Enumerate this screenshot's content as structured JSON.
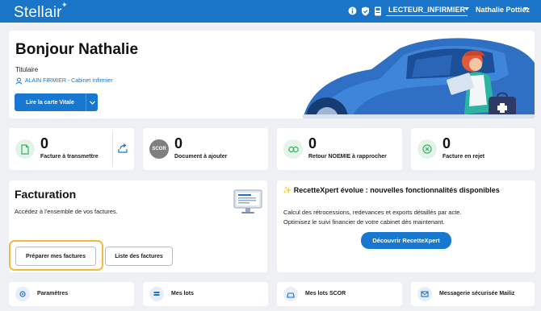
{
  "header": {
    "logo": "Stellair",
    "role_select": "LECTEUR_INFIRMIER",
    "user_menu": "Nathalie Pottiez",
    "icons": [
      "info-icon",
      "shield-icon",
      "card-reader-icon"
    ]
  },
  "hero": {
    "greeting": "Bonjour Nathalie",
    "role": "Titulaire",
    "cabinet": "ALAIN FIRMIER - Cabinet Infirmier",
    "cta_label": "Lire la carte Vitale"
  },
  "stats": [
    {
      "value": "0",
      "label": "Facture à transmettre",
      "icon": "document-icon"
    },
    {
      "value": "0",
      "label": "Document à ajouter",
      "icon": "scor-icon",
      "icon_text": "SCOR"
    },
    {
      "value": "0",
      "label": "Retour NOEMIE à rapprocher",
      "icon": "link-icon"
    },
    {
      "value": "0",
      "label": "Facture en rejet",
      "icon": "reject-icon"
    }
  ],
  "facturation": {
    "title": "Facturation",
    "subtitle": "Accédez à l'ensemble de vos factures.",
    "primary_label": "Préparer mes factures",
    "secondary_label": "Liste des factures"
  },
  "recettexpert": {
    "title": "✨ RecetteXpert évolue : nouvelles fonctionnalités disponibles",
    "line1": "Calcul des rétrocessions, redevances et exports détaillés par acte.",
    "line2": "Optimisez le suivi financier de votre cabinet dès maintenant.",
    "button_label": "Découvrir RecetteXpert"
  },
  "nav": [
    {
      "label": "Paramètres",
      "icon": "gear-icon"
    },
    {
      "label": "Mes lots",
      "icon": "stack-icon"
    },
    {
      "label": "Mes lots SCOR",
      "icon": "car-icon"
    },
    {
      "label": "Messagerie sécurisée Mailiz",
      "icon": "mail-icon"
    }
  ],
  "colors": {
    "brand_blue": "#1a74c8",
    "button_blue": "#1877cf",
    "green_icon_bg": "#e3f4e8",
    "green_icon": "#3dae63",
    "focus_yellow": "#f2b93b",
    "page_bg": "#eef0f3"
  }
}
